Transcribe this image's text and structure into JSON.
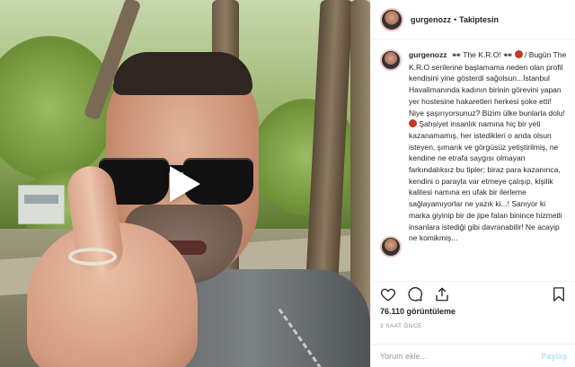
{
  "post": {
    "username": "gurgenozz",
    "separator": "•",
    "follow_status": "Takiptesin",
    "caption": {
      "username": "gurgenozz",
      "emoji1": "🕶",
      "part1": "The K.R.O!",
      "emoji2": "🕶",
      "part2": "/ Bugün The K.R.O serilerine başlamama neden olan profil kendisini yine gösterdi sağolsun...İstanbul Havalimanında kadının birinin görevini yapan yer hostesine hakaretleri herkesi şoke etti! Niye şaşırıyorsunuz? Bizim ülke bunlarla dolu!",
      "part3": "Şahsiyet insanlık namına hiç bir yeti kazanamamış, her istedikleri o anda olsun isteyen, şımarık ve görgüsüz yetiştirilmiş, ne kendine ne etrafa saygısı olmayan farkındalıksız bu tipler; biraz para kazanınca, kendini o parayla var etmeye çalışıp, kişilik kalitesi namına en ufak bir ilerleme sağlayamıyorlar ne yazık ki...! Sanıyor ki marka giyinip bir de jipe falan binince hizmetli insanlara istediği gibi davranabilir! Ne acayip ne komikmiş..."
    },
    "views": "76.110 görüntüleme",
    "time_ago": "3 SAAT ÖNCE",
    "comment_placeholder": "Yorum ekle...",
    "post_button": "Paylaş"
  },
  "icons": {
    "play": "play-icon",
    "like": "heart-icon",
    "comment": "comment-icon",
    "share": "share-icon",
    "save": "bookmark-icon"
  },
  "colors": {
    "text": "#262626",
    "muted": "#8e8e8e",
    "divider": "#efefef",
    "post_button": "#b2dffc"
  }
}
